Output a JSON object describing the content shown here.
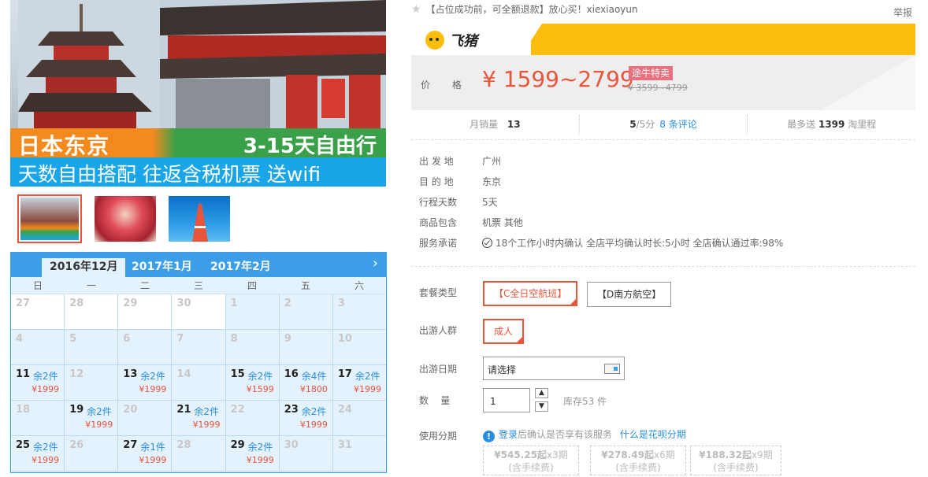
{
  "banner": {
    "destination": "日本东京",
    "duration": "3-15天自由行",
    "tagline": "天数自由搭配  往返含税机票  送wifi"
  },
  "product": {
    "title": "【占位成功前，可全额退款】放心买！xiexiaoyun",
    "report_label": "举报"
  },
  "price_box": {
    "brand": "飞猪",
    "label": "价 格",
    "price": "¥ 1599~2799",
    "badge": "途牛特卖",
    "original_price": "¥ 3599~4799"
  },
  "stats": {
    "monthly_sales_label": "月销量",
    "monthly_sales_value": "13",
    "rating_value": "5",
    "rating_suffix": "/5分",
    "reviews_link": "8 条评论",
    "points_prefix": "最多送",
    "points_value": "1399",
    "points_suffix": "淘里程"
  },
  "info": [
    {
      "key": "出 发 地",
      "value": "广州"
    },
    {
      "key": "目 的 地",
      "value": "东京"
    },
    {
      "key": "行程天数",
      "value": "5天"
    },
    {
      "key": "商品包含",
      "value": "机票  其他"
    },
    {
      "key": "服务承诺",
      "value": "18个工作小时内确认    全店平均确认时长:5小时    全店确认通过率:98%"
    }
  ],
  "options": {
    "package_label": "套餐类型",
    "packages": [
      "【C全日空航班】",
      "【D南方航空】"
    ],
    "traveler_label": "出游人群",
    "traveler": "成人",
    "date_label": "出游日期",
    "date_placeholder": "请选择",
    "qty_label": "数    量",
    "qty_value": "1",
    "stock": "库存53 件",
    "installment_label": "使用分期",
    "hb_login": "登录",
    "hb_text": "后确认是否享有该服务",
    "hb_link": "什么是花呗分期",
    "installments": [
      {
        "price": "¥545.25起",
        "periods": "x3期",
        "fee": "(含手续费)"
      },
      {
        "price": "¥278.49起",
        "periods": "x6期",
        "fee": "(含手续费)"
      },
      {
        "price": "¥188.32起",
        "periods": "x9期",
        "fee": "(含手续费)"
      }
    ]
  },
  "calendar": {
    "months": [
      "2016年12月",
      "2017年1月",
      "2017年2月"
    ],
    "active_month": 0,
    "next_arrow": "›",
    "weekdays": [
      "日",
      "一",
      "二",
      "三",
      "四",
      "五",
      "六"
    ],
    "rows": [
      [
        {
          "d": "27",
          "white": true
        },
        {
          "d": "28",
          "white": true
        },
        {
          "d": "29",
          "white": true
        },
        {
          "d": "30",
          "white": true
        },
        {
          "d": "1"
        },
        {
          "d": "2"
        },
        {
          "d": "3"
        }
      ],
      [
        {
          "d": "4"
        },
        {
          "d": "5"
        },
        {
          "d": "6"
        },
        {
          "d": "7"
        },
        {
          "d": "8"
        },
        {
          "d": "9"
        },
        {
          "d": "10"
        }
      ],
      [
        {
          "d": "11",
          "stock": "余2件",
          "price": "¥1999"
        },
        {
          "d": "12"
        },
        {
          "d": "13",
          "stock": "余2件",
          "price": "¥1999"
        },
        {
          "d": "14"
        },
        {
          "d": "15",
          "stock": "余2件",
          "price": "¥1599"
        },
        {
          "d": "16",
          "stock": "余4件",
          "price": "¥1800"
        },
        {
          "d": "17",
          "stock": "余2件",
          "price": "¥1999"
        }
      ],
      [
        {
          "d": "18"
        },
        {
          "d": "19",
          "stock": "余2件",
          "price": "¥1999"
        },
        {
          "d": "20"
        },
        {
          "d": "21",
          "stock": "余2件",
          "price": "¥1999"
        },
        {
          "d": "22"
        },
        {
          "d": "23",
          "stock": "余2件",
          "price": "¥1999"
        },
        {
          "d": "24"
        }
      ],
      [
        {
          "d": "25",
          "stock": "余2件",
          "price": "¥1999"
        },
        {
          "d": "26"
        },
        {
          "d": "27",
          "stock": "余1件",
          "price": "¥1999"
        },
        {
          "d": "28"
        },
        {
          "d": "29",
          "stock": "余2件",
          "price": "¥1999"
        },
        {
          "d": "30"
        },
        {
          "d": "31"
        }
      ]
    ]
  }
}
